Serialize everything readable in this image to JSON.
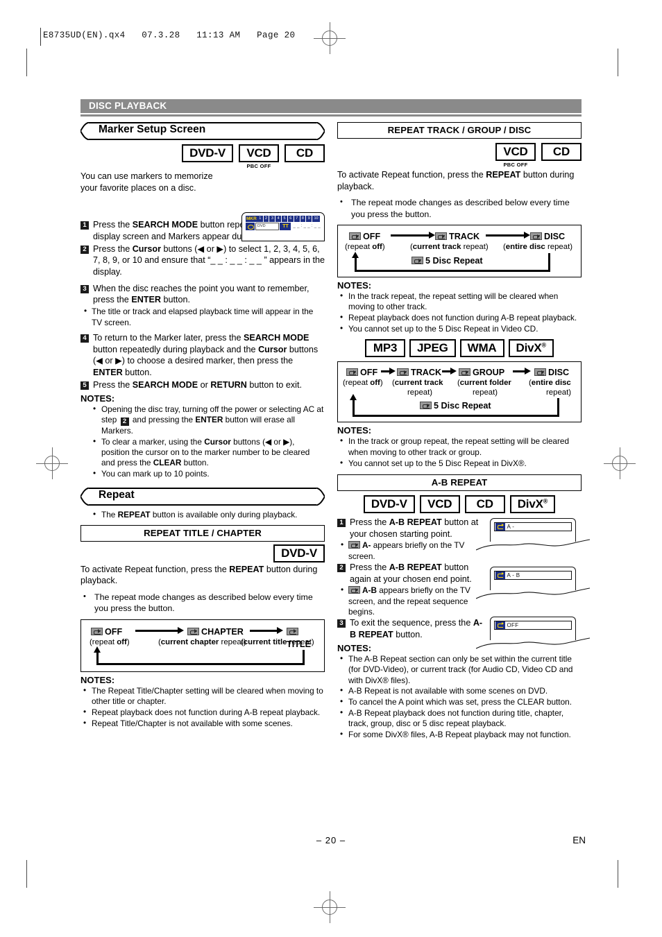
{
  "slug": "E8735UD(EN).qx4   07.3.28   11:13 AM   Page 20",
  "section": {
    "title": "DISC PLAYBACK"
  },
  "footer": {
    "page": "– 20 –",
    "lang": "EN"
  },
  "icons": {
    "repeat": "repeat-icon",
    "marker": "marker-display-icon",
    "registration": "registration-mark-icon"
  },
  "left": {
    "marker": {
      "banner": "Marker Setup Screen",
      "badges": [
        {
          "label": "DVD-V",
          "sub": ""
        },
        {
          "label": "VCD",
          "sub": "PBC OFF"
        },
        {
          "label": "CD",
          "sub": ""
        }
      ],
      "intro": "You can use markers to memorize your favorite places on a disc.",
      "display": {
        "tag": "MKR",
        "numbers": [
          "1",
          "2",
          "3",
          "4",
          "5",
          "6",
          "7",
          "8",
          "9",
          "10"
        ],
        "field": "DVD",
        "tt": "TT",
        "time": "_ _ : _ _ : _ _"
      },
      "steps": [
        {
          "n": "1",
          "text_pre": "Press the ",
          "bold1": "SEARCH MODE",
          "text_post": " button repeatedly until the display screen and Markers appear during playback."
        },
        {
          "n": "2",
          "text_pre": "Press the ",
          "bold1": "Cursor",
          "text_post": " buttons (◀ or ▶) to select 1, 2, 3, 4, 5, 6, 7, 8, 9, or 10 and ensure that “_ _ : _ _ : _ _ ” appears in the display."
        },
        {
          "n": "3",
          "text_pre": "When the disc reaches the point you want to remember, press the ",
          "bold1": "ENTER",
          "text_post": " button."
        },
        {
          "n": "4",
          "text_pre": "To return to the Marker later, press the ",
          "bold1": "SEARCH MODE",
          "text_post": " button repeatedly during playback and the ",
          "bold2": "Cursor",
          "text_post2": " buttons (◀ or ▶) to choose a desired marker, then press the ",
          "bold3": "ENTER",
          "text_post3": " button."
        },
        {
          "n": "5",
          "text_pre": "Press the ",
          "bold1": "SEARCH MODE",
          "mid": " or ",
          "bold2": "RETURN",
          "text_post": " button to exit."
        }
      ],
      "step3_sub": "The title or track and elapsed playback time will appear in the TV screen.",
      "notes_heading": "NOTES:",
      "notes": [
        {
          "a": "Opening the disc tray, turning off the power or selecting AC at step ",
          "stepnum": "2",
          "b": " and pressing the ",
          "bold": "ENTER",
          "c": " button will erase all Markers."
        },
        {
          "a": "To clear a marker, using the ",
          "bold": "Cursor",
          "b": " buttons (◀ or ▶), position the cursor on to the marker number to be cleared and press the ",
          "bold2": "CLEAR",
          "c": " button."
        },
        {
          "a": "You can mark up to 10 points."
        }
      ]
    },
    "repeat": {
      "banner": "Repeat",
      "bullet": {
        "a": "The ",
        "bold": "REPEAT",
        "b": " button is available only during playback."
      },
      "boxtitle": "REPEAT TITLE / CHAPTER",
      "badges": [
        {
          "label": "DVD-V",
          "sub": ""
        }
      ],
      "intro": {
        "a": "To activate Repeat function, press the ",
        "bold": "REPEAT",
        "b": " button during playback."
      },
      "bullet2": "The repeat mode changes as described below every time you press the button.",
      "flow": {
        "nodes": [
          {
            "label": "OFF",
            "sub_bold_first": false,
            "sub_a": "(repeat ",
            "sub_b": "off",
            "sub_c": ")"
          },
          {
            "label": "CHAPTER",
            "sub_a": "(",
            "sub_b": "current chapter",
            "sub_c": " repeat)"
          },
          {
            "label": "TITLE",
            "sub_a": "(",
            "sub_b": "current title",
            "sub_c": " repeat)"
          }
        ]
      },
      "notes_heading": "NOTES:",
      "notes": [
        "The Repeat Title/Chapter setting will be cleared when moving to other title or chapter.",
        "Repeat playback does not function during A-B repeat playback.",
        "Repeat Title/Chapter is not available with some scenes."
      ]
    }
  },
  "right": {
    "track_group_disc": {
      "boxtitle": "REPEAT TRACK / GROUP / DISC",
      "badges": [
        {
          "label": "VCD",
          "sub": "PBC OFF"
        },
        {
          "label": "CD",
          "sub": ""
        }
      ],
      "intro": {
        "a": "To activate Repeat function, press the ",
        "bold": "REPEAT",
        "b": " button during playback."
      },
      "bullet2": "The repeat mode changes as described below every time you press the button.",
      "flow": {
        "nodes": [
          {
            "label": "OFF",
            "sub_a": "(repeat ",
            "sub_b": "off",
            "sub_c": ")"
          },
          {
            "label": "TRACK",
            "sub_a": "(",
            "sub_b": "current track",
            "sub_c": " repeat)"
          },
          {
            "label": "DISC",
            "sub_a": "(",
            "sub_b": "entire disc",
            "sub_c": " repeat)"
          }
        ],
        "fivedisc": "5 Disc Repeat"
      },
      "notes_heading": "NOTES:",
      "notes": [
        "In the track repeat, the repeat setting will be cleared when moving to other track.",
        "Repeat playback does not function during A-B repeat playback.",
        "You cannot set up to the 5 Disc Repeat in Video CD."
      ]
    },
    "media_repeat": {
      "badges": [
        {
          "label": "MP3",
          "sub": ""
        },
        {
          "label": "JPEG",
          "sub": ""
        },
        {
          "label": "WMA",
          "sub": ""
        },
        {
          "label": "DivX",
          "reg": true,
          "sub": ""
        }
      ],
      "flow": {
        "nodes": [
          {
            "label": "OFF",
            "sub_a": "(repeat ",
            "sub_b": "off",
            "sub_c": ")",
            "sub2": ""
          },
          {
            "label": "TRACK",
            "sub_a": "(",
            "sub_b": "current track",
            "sub_c": "",
            "sub2": "repeat)"
          },
          {
            "label": "GROUP",
            "sub_a": "(",
            "sub_b": "current folder",
            "sub_c": "",
            "sub2": "repeat)"
          },
          {
            "label": "DISC",
            "sub_a": "(",
            "sub_b": "entire disc",
            "sub_c": "",
            "sub2": "repeat)"
          }
        ],
        "fivedisc": "5 Disc Repeat"
      },
      "notes_heading": "NOTES:",
      "notes": [
        "In the track or group repeat, the repeat setting will be cleared when moving to other track or group.",
        "You cannot set up to the 5 Disc Repeat in DivX®."
      ]
    },
    "ab_repeat": {
      "boxtitle": "A-B REPEAT",
      "badges": [
        {
          "label": "DVD-V",
          "sub": ""
        },
        {
          "label": "VCD",
          "sub": ""
        },
        {
          "label": "CD",
          "sub": ""
        },
        {
          "label": "DivX",
          "reg": true,
          "sub": ""
        }
      ],
      "steps": [
        {
          "n": "1",
          "a": "Press the ",
          "bold": "A-B REPEAT",
          "b": " button at your chosen starting point.",
          "sub_bold": "A-",
          "sub_text": " appears briefly on the TV screen.",
          "screen": "A -"
        },
        {
          "n": "2",
          "a": "Press the ",
          "bold": "A-B REPEAT",
          "b": " button again at your chosen end point.",
          "sub_bold": "A-B",
          "sub_text": " appears briefly on the TV screen, and the repeat sequence begins.",
          "screen": "A - B"
        },
        {
          "n": "3",
          "a": "To exit the sequence, press the ",
          "bold": "A-B REPEAT",
          "b": " button.",
          "screen": "OFF"
        }
      ],
      "notes_heading": "NOTES:",
      "notes": [
        "The A-B Repeat section can only be set within the current title (for DVD-Video), or current track (for Audio CD, Video CD and with DivX® files).",
        "A-B Repeat is not available with some scenes on DVD.",
        "To cancel the A point which was set, press the CLEAR button.",
        "A-B Repeat playback does not function during title, chapter, track, group, disc or 5 disc repeat playback.",
        "For some DivX® files, A-B Repeat playback may not function."
      ]
    }
  },
  "colors": {
    "section_bar": "#8a8a8a",
    "osd_blue": "#1d2f86",
    "osd_yellow": "#ffd800",
    "icon_gray": "#9a9a9a"
  }
}
